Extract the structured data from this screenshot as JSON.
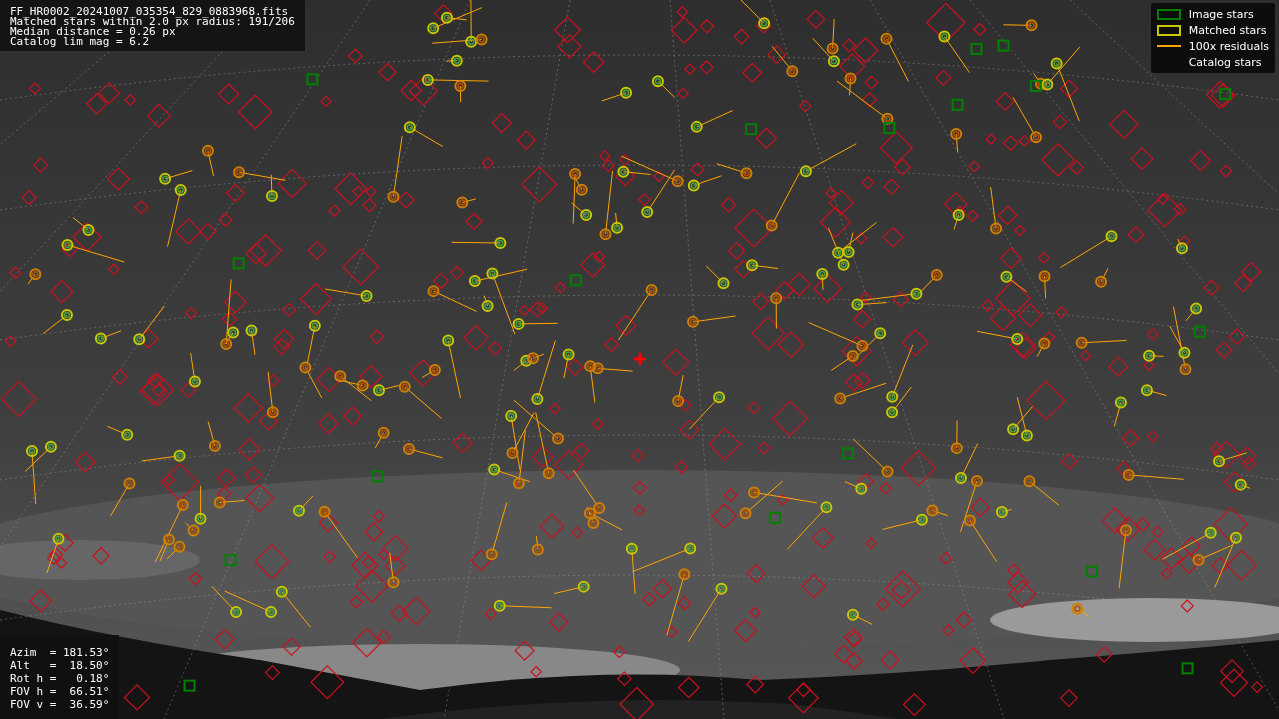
{
  "info_box": {
    "lines": [
      "FF_HR0002_20241007_035354_829_0883968.fits",
      "Matched stars within 2.0 px radius: 191/206",
      "Median distance = 0.26 px",
      "Catalog lim mag = 6.2"
    ]
  },
  "legend": [
    {
      "label": "Image stars",
      "kind": "rect",
      "color": "#008000"
    },
    {
      "label": "Matched stars",
      "kind": "rect",
      "color": "#c8c800"
    },
    {
      "label": "100x residuals",
      "kind": "line",
      "color": "#ffa500"
    },
    {
      "label": "Catalog stars",
      "kind": "none"
    }
  ],
  "pointing": {
    "lines": [
      "Azim  = 181.53°",
      "Alt   =  18.50°",
      "Rot h =   0.18°",
      "FOV h =  66.51°",
      "FOV v =  36.59°"
    ]
  }
}
